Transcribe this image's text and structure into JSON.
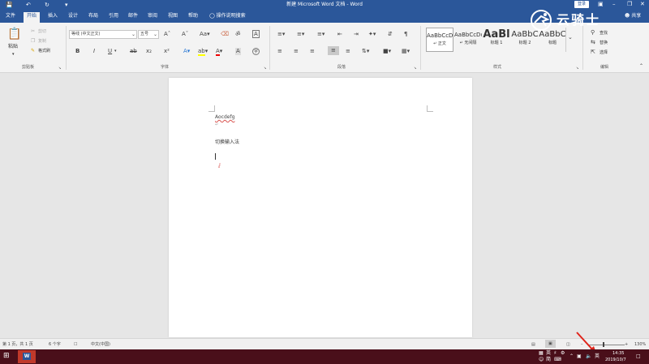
{
  "titlebar": {
    "title": "新建 Microsoft Word 文档 - Word",
    "login": "登录",
    "qat": [
      "save-icon",
      "undo-icon",
      "redo-icon",
      "customize-icon"
    ]
  },
  "tabs": {
    "items": [
      "文件",
      "开始",
      "插入",
      "设计",
      "布局",
      "引用",
      "邮件",
      "审阅",
      "视图",
      "帮助"
    ],
    "active": "开始",
    "search": "操作说明搜索",
    "share": "共享"
  },
  "ribbon": {
    "clipboard": {
      "paste": "粘贴",
      "cut": "剪切",
      "copy": "复制",
      "format_painter": "格式刷",
      "label": "剪贴板"
    },
    "font": {
      "font_name": "等线 (中文正文)",
      "font_size": "五号",
      "label": "字体"
    },
    "paragraph": {
      "label": "段落"
    },
    "styles": {
      "label": "样式",
      "items": [
        {
          "preview": "AaBbCcDc",
          "name": "正文"
        },
        {
          "preview": "AaBbCcDc",
          "name": "无间隔"
        },
        {
          "preview": "AaBl",
          "name": "标题 1"
        },
        {
          "preview": "AaBbC",
          "name": "标题 2"
        },
        {
          "preview": "AaBbC",
          "name": "标题"
        }
      ]
    },
    "editing": {
      "find": "查找",
      "replace": "替换",
      "select": "选择",
      "label": "编辑"
    }
  },
  "document": {
    "lines": [
      "Aocdefg",
      "切换输入法"
    ]
  },
  "status": {
    "page": "第 1 页，共 1 页",
    "words": "6 个字",
    "language": "中文(中国)",
    "zoom": "130%"
  },
  "taskbar": {
    "ime_top": "英",
    "ime_bottom": "简",
    "tray_lang": "英",
    "time": "14:35",
    "date": "2019/10/7"
  },
  "watermark": {
    "text": "云骑士"
  },
  "colors": {
    "word_blue": "#2b579a",
    "taskbar": "#4a0f1a",
    "arrow": "#e0241b"
  }
}
